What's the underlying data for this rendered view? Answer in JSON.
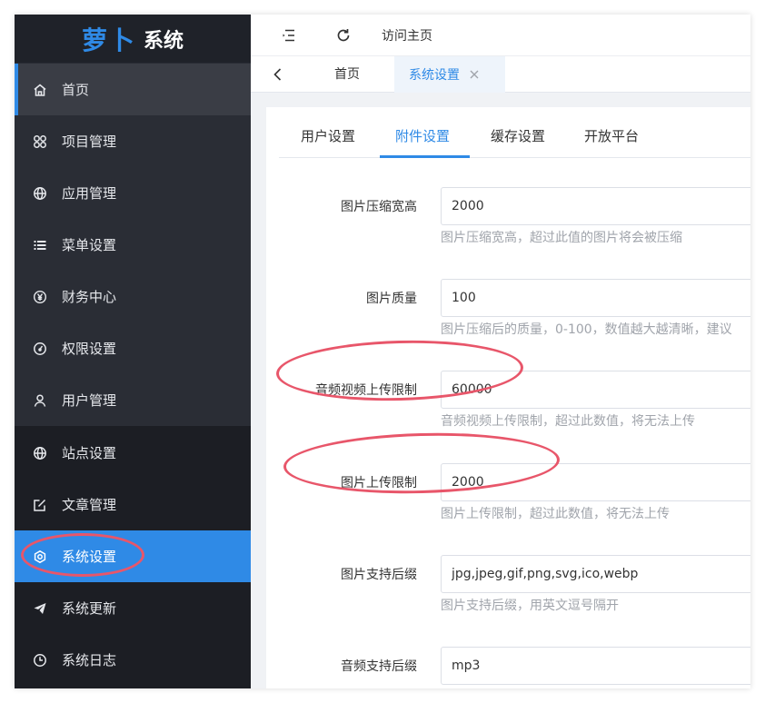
{
  "logo": {
    "brand": "萝卜",
    "name": "系统"
  },
  "sidebar": {
    "items": [
      {
        "label": "首页",
        "icon": "home-icon"
      },
      {
        "label": "项目管理",
        "icon": "apps-icon"
      },
      {
        "label": "应用管理",
        "icon": "globe-icon"
      },
      {
        "label": "菜单设置",
        "icon": "list-icon"
      },
      {
        "label": "财务中心",
        "icon": "yen-icon"
      },
      {
        "label": "权限设置",
        "icon": "gauge-icon"
      },
      {
        "label": "用户管理",
        "icon": "user-icon"
      },
      {
        "label": "站点设置",
        "icon": "globe-icon"
      },
      {
        "label": "文章管理",
        "icon": "edit-icon"
      },
      {
        "label": "系统设置",
        "icon": "gear-icon"
      },
      {
        "label": "系统更新",
        "icon": "send-icon"
      },
      {
        "label": "系统日志",
        "icon": "clock-icon"
      }
    ]
  },
  "topbar": {
    "visit_label": "访问主页"
  },
  "tabs": {
    "home_label": "首页",
    "active_label": "系统设置"
  },
  "subtabs": [
    "用户设置",
    "附件设置",
    "缓存设置",
    "开放平台"
  ],
  "form": {
    "fields": [
      {
        "label": "图片压缩宽高",
        "value": "2000",
        "hint": "图片压缩宽高，超过此值的图片将会被压缩"
      },
      {
        "label": "图片质量",
        "value": "100",
        "hint": "图片压缩后的质量，0-100，数值越大越清晰，建议"
      },
      {
        "label": "音频视频上传限制",
        "value": "60000",
        "hint": "音频视频上传限制，超过此数值，将无法上传"
      },
      {
        "label": "图片上传限制",
        "value": "2000",
        "hint": "图片上传限制，超过此数值，将无法上传"
      },
      {
        "label": "图片支持后缀",
        "value": "jpg,jpeg,gif,png,svg,ico,webp",
        "hint": "图片支持后缀，用英文逗号隔开"
      },
      {
        "label": "音频支持后缀",
        "value": "mp3"
      }
    ]
  },
  "colors": {
    "accent": "#2f8ae6",
    "sidebar_bg": "#1f2229",
    "annotation": "#e8566a"
  }
}
